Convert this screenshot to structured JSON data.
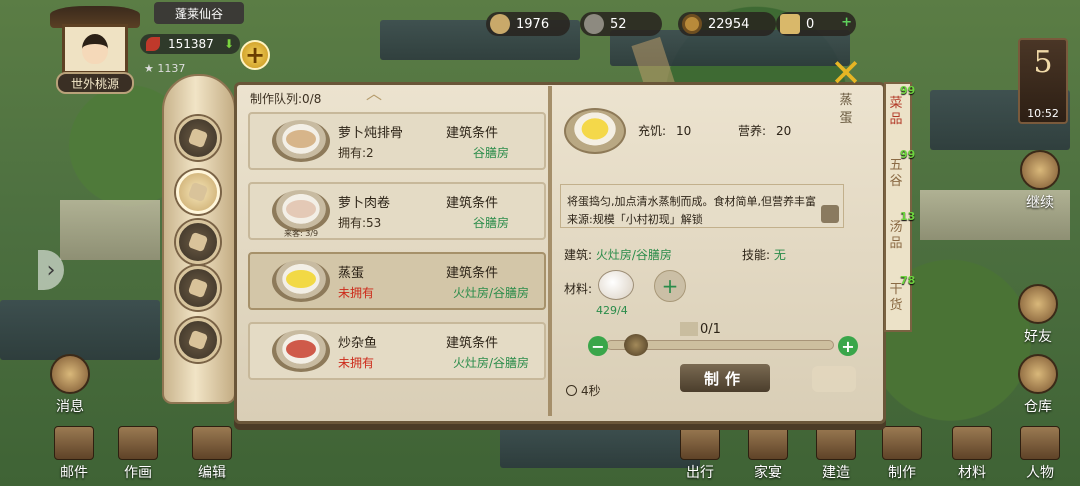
{
  "player": {
    "badge": "世外桃源",
    "location": "蓬莱仙谷",
    "power": "151387",
    "stat_obscured": "1137"
  },
  "resources": [
    {
      "icon": "rice-icon",
      "value": "1976"
    },
    {
      "icon": "fish-icon",
      "value": "52"
    },
    {
      "icon": "coin-icon",
      "value": "22954"
    },
    {
      "icon": "scroll-icon",
      "value": "0"
    }
  ],
  "day": {
    "number": "5",
    "time": "10:52"
  },
  "side_right": {
    "continue": "继续",
    "friends": "好友",
    "warehouse": "仓库"
  },
  "side_left": {
    "news": "消息"
  },
  "bottom_nav": [
    "邮件",
    "作画",
    "编辑",
    "出行",
    "家宴",
    "建造",
    "制作",
    "材料",
    "人物"
  ],
  "panel": {
    "queue_label": "制作队列:0/8",
    "cond_label": "建筑条件",
    "recipes": [
      {
        "name": "萝卜炖排骨",
        "own": "拥有:2",
        "cond": "谷膳房",
        "owned": true,
        "food_color": "#d7b58a"
      },
      {
        "name": "萝卜肉卷",
        "own": "拥有:53",
        "cond": "谷膳房",
        "owned": true,
        "food_color": "#e4c9b6",
        "badge": "来客: 3/9"
      },
      {
        "name": "蒸蛋",
        "own": "未拥有",
        "cond": "火灶房/谷膳房",
        "owned": false,
        "food_color": "#f2d945"
      },
      {
        "name": "炒杂鱼",
        "own": "未拥有",
        "cond": "火灶房/谷膳房",
        "owned": false,
        "food_color": "#cf5a4a"
      }
    ]
  },
  "detail": {
    "title": "蒸蛋",
    "hunger_label": "充饥:",
    "hunger": "10",
    "nutrition_label": "营养:",
    "nutrition": "20",
    "desc_line1": "将蛋捣匀,加点清水蒸制而成。食材简单,但营养丰富",
    "desc_line2": "来源:规模「小村初现」解锁",
    "building_label": "建筑:",
    "building_value": "火灶房/谷膳房",
    "skill_label": "技能:",
    "skill_value": "无",
    "materials_label": "材料:",
    "material_count": "429/4",
    "quantity": "0/1",
    "time": "4秒",
    "make_label": "制作"
  },
  "category_tabs": [
    {
      "label": "菜品",
      "count": "99",
      "active": true
    },
    {
      "label": "五谷",
      "count": "99",
      "active": false
    },
    {
      "label": "汤品",
      "count": "13",
      "active": false
    },
    {
      "label": "干货",
      "count": "78",
      "active": false
    }
  ]
}
